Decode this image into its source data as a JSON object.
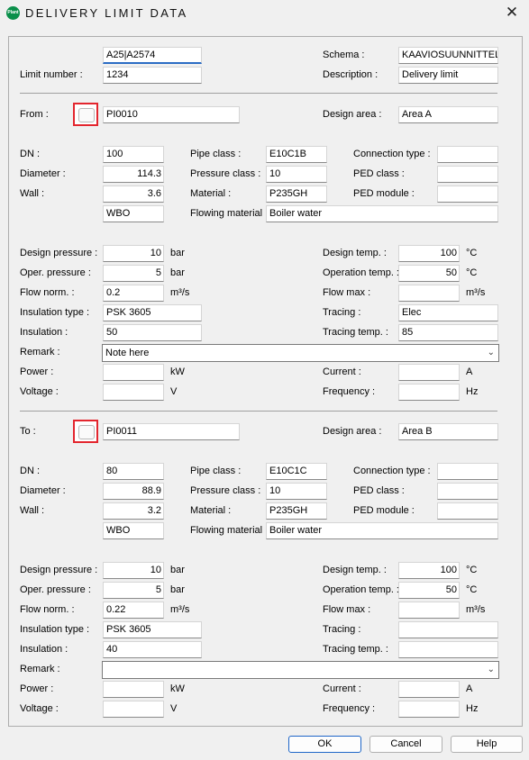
{
  "window": {
    "title": "DELIVERY LIMIT DATA",
    "app_icon_text": "Plant",
    "close_glyph": "✕"
  },
  "header": {
    "limit_number_label": "Limit number :",
    "limit_id_value": "A25|A2574",
    "limit_number_value": "1234",
    "schema_label": "Schema :",
    "schema_value": "KAAVIOSUUNNITTEL",
    "description_label": "Description :",
    "description_value": "Delivery limit"
  },
  "from": {
    "label": "From :",
    "point_value": "PI0010",
    "design_area_label": "Design area :",
    "design_area_value": "Area A",
    "dn_label": "DN :",
    "dn_value": "100",
    "diameter_label": "Diameter :",
    "diameter_value": "114.3",
    "wall_label": "Wall :",
    "wall_value": "3.6",
    "wall_std_value": "WBO",
    "pipe_class_label": "Pipe class :",
    "pipe_class_value": "E10C1B",
    "pressure_class_label": "Pressure class :",
    "pressure_class_value": "10",
    "material_label": "Material :",
    "material_value": "P235GH",
    "flowing_material_label": "Flowing material :",
    "flowing_material_value": "Boiler water",
    "connection_type_label": "Connection type :",
    "connection_type_value": "",
    "ped_class_label": "PED class :",
    "ped_class_value": "",
    "ped_module_label": "PED module :",
    "ped_module_value": "",
    "design_pressure_label": "Design pressure :",
    "design_pressure_value": "10",
    "design_pressure_unit": "bar",
    "oper_pressure_label": "Oper. pressure :",
    "oper_pressure_value": "5",
    "oper_pressure_unit": "bar",
    "flow_norm_label": "Flow norm. :",
    "flow_norm_value": "0.2",
    "flow_norm_unit": "m³/s",
    "insulation_type_label": "Insulation type :",
    "insulation_type_value": "PSK 3605",
    "insulation_label": "Insulation :",
    "insulation_value": "50",
    "remark_label": "Remark :",
    "remark_value": "Note here",
    "power_label": "Power :",
    "power_value": "",
    "power_unit": "kW",
    "voltage_label": "Voltage :",
    "voltage_value": "",
    "voltage_unit": "V",
    "design_temp_label": "Design temp. :",
    "design_temp_value": "100",
    "design_temp_unit": "°C",
    "operation_temp_label": "Operation temp. :",
    "operation_temp_value": "50",
    "operation_temp_unit": "°C",
    "flow_max_label": "Flow max :",
    "flow_max_value": "",
    "flow_max_unit": "m³/s",
    "tracing_label": "Tracing :",
    "tracing_value": "Elec",
    "tracing_temp_label": "Tracing temp. :",
    "tracing_temp_value": "85",
    "current_label": "Current :",
    "current_value": "",
    "current_unit": "A",
    "frequency_label": "Frequency :",
    "frequency_value": "",
    "frequency_unit": "Hz"
  },
  "to": {
    "label": "To :",
    "point_value": "PI0011",
    "design_area_label": "Design area :",
    "design_area_value": "Area B",
    "dn_label": "DN :",
    "dn_value": "80",
    "diameter_label": "Diameter :",
    "diameter_value": "88.9",
    "wall_label": "Wall :",
    "wall_value": "3.2",
    "wall_std_value": "WBO",
    "pipe_class_label": "Pipe class :",
    "pipe_class_value": "E10C1C",
    "pressure_class_label": "Pressure class :",
    "pressure_class_value": "10",
    "material_label": "Material :",
    "material_value": "P235GH",
    "flowing_material_label": "Flowing material :",
    "flowing_material_value": "Boiler water",
    "connection_type_label": "Connection type :",
    "connection_type_value": "",
    "ped_class_label": "PED class :",
    "ped_class_value": "",
    "ped_module_label": "PED module :",
    "ped_module_value": "",
    "design_pressure_label": "Design pressure :",
    "design_pressure_value": "10",
    "design_pressure_unit": "bar",
    "oper_pressure_label": "Oper. pressure :",
    "oper_pressure_value": "5",
    "oper_pressure_unit": "bar",
    "flow_norm_label": "Flow norm. :",
    "flow_norm_value": "0.22",
    "flow_norm_unit": "m³/s",
    "insulation_type_label": "Insulation type :",
    "insulation_type_value": "PSK 3605",
    "insulation_label": "Insulation :",
    "insulation_value": "40",
    "remark_label": "Remark :",
    "remark_value": "",
    "power_label": "Power :",
    "power_value": "",
    "power_unit": "kW",
    "voltage_label": "Voltage :",
    "voltage_value": "",
    "voltage_unit": "V",
    "design_temp_label": "Design temp. :",
    "design_temp_value": "100",
    "design_temp_unit": "°C",
    "operation_temp_label": "Operation temp. :",
    "operation_temp_value": "50",
    "operation_temp_unit": "°C",
    "flow_max_label": "Flow max :",
    "flow_max_value": "",
    "flow_max_unit": "m³/s",
    "tracing_label": "Tracing :",
    "tracing_value": "",
    "tracing_temp_label": "Tracing temp. :",
    "tracing_temp_value": "",
    "current_label": "Current :",
    "current_value": "",
    "current_unit": "A",
    "frequency_label": "Frequency :",
    "frequency_value": "",
    "frequency_unit": "Hz"
  },
  "buttons": {
    "ok": "OK",
    "cancel": "Cancel",
    "help": "Help"
  },
  "colors": {
    "highlight_box": "#e3262e",
    "focus_underline": "#2b6cc4",
    "default_button_border": "#1e66c8"
  }
}
